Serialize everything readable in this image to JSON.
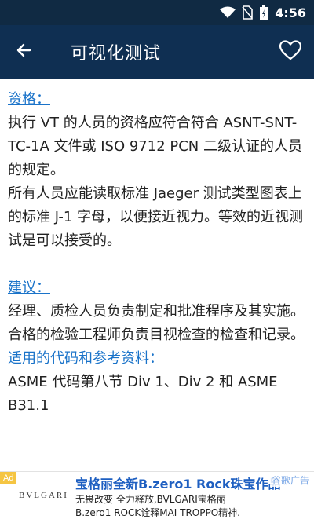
{
  "status_bar": {
    "time": "4:56",
    "icons": [
      "wifi-icon",
      "no-sim-icon",
      "battery-charging-icon"
    ]
  },
  "app_bar": {
    "title": "可视化测试",
    "back_icon": "arrow-left-icon",
    "favorite_icon": "heart-outline-icon"
  },
  "content": {
    "qualification_heading": "资格：",
    "qualification_p1": "执行 VT 的人员的资格应符合符合 ASNT-SNT-TC-1A 文件或 ISO 9712 PCN 二级认证的人员的规定。",
    "qualification_p2": "所有人员应能读取标准 Jaeger 测试类型图表上的标准 J-1 字母，以便接近视力。等效的近视测试是可以接受的。",
    "recommendation_heading": "建议：",
    "recommendation_p1": "经理、质检人员负责制定和批准程序及其实施。",
    "recommendation_p2": "合格的检验工程师负责目视检查的检查和记录。",
    "codes_heading": "适用的代码和参考资料：",
    "codes_p1": "ASME 代码第八节 Div 1、Div 2 和 ASME B31.1"
  },
  "ad": {
    "badge": "Ad",
    "logo_text": "BVLGARI",
    "title": "宝格丽全新B.zero1 Rock珠宝作品",
    "line1": "无畏改变 全力释放,BVLGARI宝格丽",
    "line2": "B.zero1 ROCK诠释MAI TROPPO精神.",
    "google_label": "谷歌广告"
  },
  "colors": {
    "status_bar_bg": "#102a43",
    "app_bar_bg": "#0f2f52",
    "heading_link": "#1a73c9",
    "ad_title": "#1e5fc1"
  }
}
